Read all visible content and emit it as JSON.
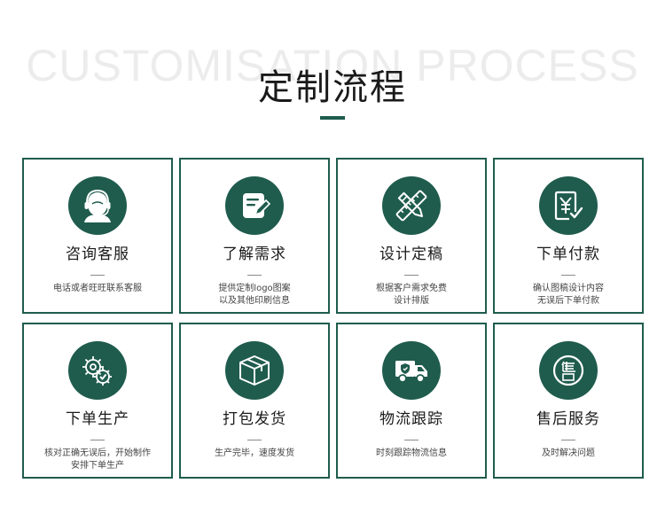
{
  "header": {
    "bg_title": "CUSTOMISATION PROCESS",
    "title": "定制流程"
  },
  "colors": {
    "accent": "#1f5c4d"
  },
  "steps": [
    {
      "icon": "customer-service-icon",
      "title": "咨询客服",
      "desc": [
        "电话或者旺旺联系客服"
      ]
    },
    {
      "icon": "notepad-edit-icon",
      "title": "了解需求",
      "desc": [
        "提供定制logo图案",
        "以及其他印刷信息"
      ]
    },
    {
      "icon": "ruler-pencil-icon",
      "title": "设计定稿",
      "desc": [
        "根据客户需求免费",
        "设计排版"
      ]
    },
    {
      "icon": "yen-payment-icon",
      "title": "下单付款",
      "desc": [
        "确认图稿设计内容",
        "无误后下单付款"
      ]
    },
    {
      "icon": "gears-icon",
      "title": "下单生产",
      "desc": [
        "核对正确无误后，开始制作",
        "安排下单生产"
      ]
    },
    {
      "icon": "package-box-icon",
      "title": "打包发货",
      "desc": [
        "生产完毕，速度发货"
      ]
    },
    {
      "icon": "delivery-truck-icon",
      "title": "物流跟踪",
      "desc": [
        "时刻跟踪物流信息"
      ]
    },
    {
      "icon": "after-sales-icon",
      "title": "售后服务",
      "desc": [
        "及时解决问题"
      ]
    }
  ]
}
